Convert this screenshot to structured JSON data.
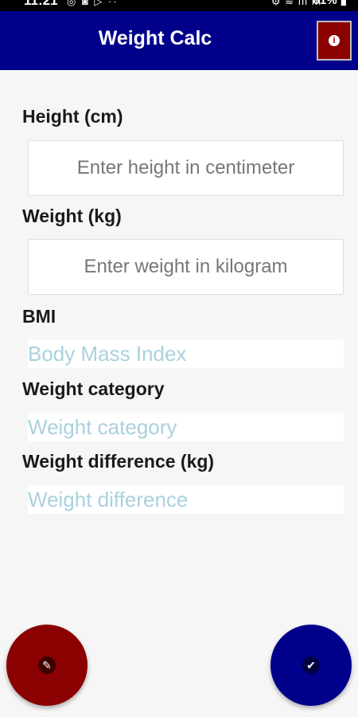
{
  "status_bar": {
    "time": "11:21",
    "left_icons": "◎ ◙ ▷ ··",
    "right_icons": "⚙ ≋ ıll ıll",
    "battery": "81% ▮"
  },
  "app_bar": {
    "title": "Weight Calc",
    "info_icon_glyph": "i"
  },
  "form": {
    "height": {
      "label": "Height (cm)",
      "placeholder": "Enter height in centimeter",
      "value": ""
    },
    "weight": {
      "label": "Weight (kg)",
      "placeholder": "Enter weight in kilogram",
      "value": ""
    },
    "bmi": {
      "label": "BMI",
      "value": "Body Mass Index"
    },
    "category": {
      "label": "Weight category",
      "value": "Weight category"
    },
    "difference": {
      "label": "Weight difference (kg)",
      "value": "Weight difference"
    }
  },
  "fabs": {
    "edit_icon": "✎",
    "done_icon": "✔"
  },
  "colors": {
    "app_bar": "#00008b",
    "info_button": "#8b0000",
    "edit_fab": "#8b0000",
    "done_fab": "#00008b",
    "output_text": "#a9d1de"
  }
}
